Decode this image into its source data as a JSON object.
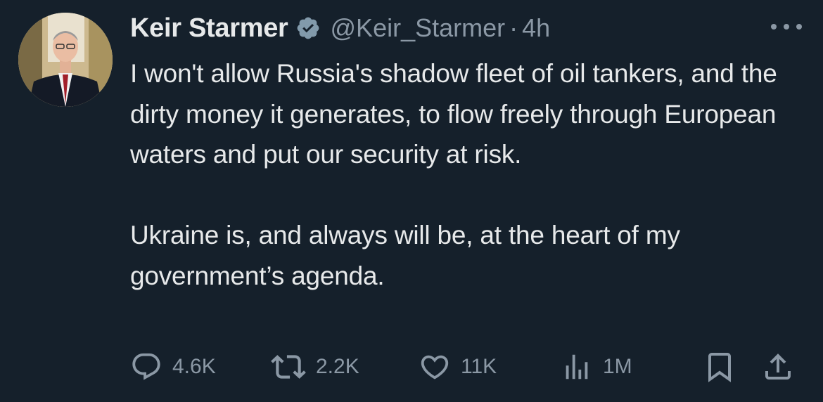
{
  "author": {
    "display_name": "Keir Starmer",
    "handle": "@Keir_Starmer",
    "separator": "·",
    "time": "4h",
    "verified_badge": "verified-badge-icon"
  },
  "tweet": {
    "paragraphs": [
      "I won't allow Russia's shadow fleet of oil tankers, and the dirty money it generates, to flow freely through European waters and put our security at risk.",
      "Ukraine is, and always will be, at the heart of my government’s agenda."
    ]
  },
  "metrics": {
    "replies": "4.6K",
    "reposts": "2.2K",
    "likes": "11K",
    "views": "1M"
  },
  "icons": {
    "reply": "reply-icon",
    "repost": "repost-icon",
    "like": "heart-icon",
    "views": "views-chart-icon",
    "bookmark": "bookmark-icon",
    "share": "share-icon",
    "more": "more-dots-icon"
  },
  "colors": {
    "background": "#15202b",
    "text_primary": "#e7e9ea",
    "text_secondary": "#8b98a5",
    "verified_badge": "#829aab"
  }
}
